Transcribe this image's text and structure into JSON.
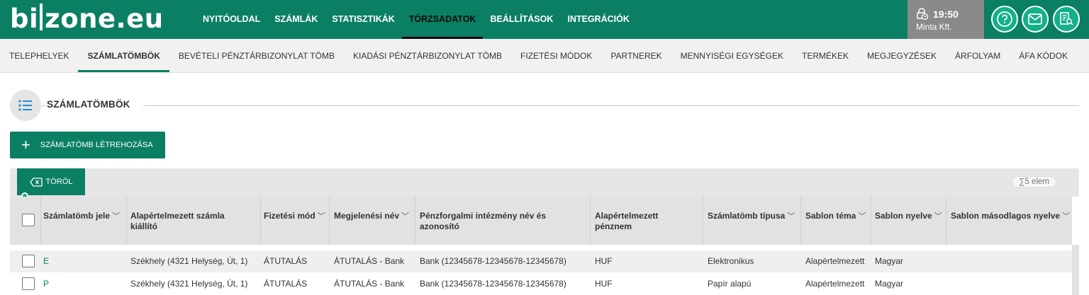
{
  "brand": {
    "logo_left": "bi",
    "logo_right": "zone.eu"
  },
  "main_nav": [
    {
      "label": "NYITÓOLDAL"
    },
    {
      "label": "SZÁMLÁK"
    },
    {
      "label": "STATISZTIKÁK"
    },
    {
      "label": "TÖRZSADATOK",
      "active": true
    },
    {
      "label": "BEÁLLÍTÁSOK"
    },
    {
      "label": "INTEGRÁCIÓK"
    }
  ],
  "user": {
    "time": "19:50",
    "company": "Minta Kft."
  },
  "header_icons": [
    "help-icon",
    "mail-icon",
    "documents-icon"
  ],
  "sub_nav": [
    {
      "label": "TELEPHELYEK"
    },
    {
      "label": "SZÁMLATÖMBÖK",
      "active": true
    },
    {
      "label": "BEVÉTELI PÉNZTÁRBIZONYLAT TÖMB"
    },
    {
      "label": "KIADÁSI PÉNZTÁRBIZONYLAT TÖMB"
    },
    {
      "label": "FIZETÉSI MÓDOK"
    },
    {
      "label": "PARTNEREK"
    },
    {
      "label": "MENNYISÉGI EGYSÉGEK"
    },
    {
      "label": "TERMÉKEK"
    },
    {
      "label": "MEGJEGYZÉSEK"
    },
    {
      "label": "ÁRFOLYAM"
    },
    {
      "label": "ÁFA KÓDOK"
    }
  ],
  "section": {
    "title": "SZÁMLATÖMBÖK",
    "icon": "list-icon"
  },
  "create_button": {
    "label": "SZÁMLATÖMB LÉTREHOZÁSA"
  },
  "toolbar": {
    "delete_label": "TÖRÖL",
    "count": "5 elem",
    "count_symbol": "∑"
  },
  "table": {
    "columns": [
      {
        "line1": "Számlatömb jele",
        "line2": "",
        "sortable": true
      },
      {
        "line1": "Alapértelmezett számla",
        "line2": "kiállító",
        "sortable": false
      },
      {
        "line1": "Fizetési mód",
        "line2": "",
        "sortable": true
      },
      {
        "line1": "Megjelenési név",
        "line2": "",
        "sortable": true
      },
      {
        "line1": "Pénzforgalmi intézmény név és",
        "line2": "azonosító",
        "sortable": false
      },
      {
        "line1": "Alapértelmezett",
        "line2": "pénznem",
        "sortable": false
      },
      {
        "line1": "Számlatömb típusa",
        "line2": "",
        "sortable": true
      },
      {
        "line1": "Sablon téma",
        "line2": "",
        "sortable": true
      },
      {
        "line1": "Sablon nyelve",
        "line2": "",
        "sortable": true
      },
      {
        "line1": "Sablon másodlagos nyelve",
        "line2": "",
        "sortable": true
      }
    ],
    "rows": [
      [
        "E",
        "Székhely (4321 Helység, Út, 1)",
        "ÁTUTALÁS",
        "ÁTUTALÁS - Bank",
        "Bank (12345678-12345678-12345678)",
        "HUF",
        "Elektronikus",
        "Alapértelmezett",
        "Magyar",
        ""
      ],
      [
        "P",
        "Székhely (4321 Helység, Út, 1)",
        "ÁTUTALÁS",
        "ÁTUTALÁS - Bank",
        "Bank (12345678-12345678-12345678)",
        "HUF",
        "Papír alapú",
        "Alapértelmezett",
        "Magyar",
        ""
      ]
    ]
  },
  "colors": {
    "primary": "#0b7f63",
    "accent": "#13b08a",
    "user_bg": "#8a8a8a"
  }
}
